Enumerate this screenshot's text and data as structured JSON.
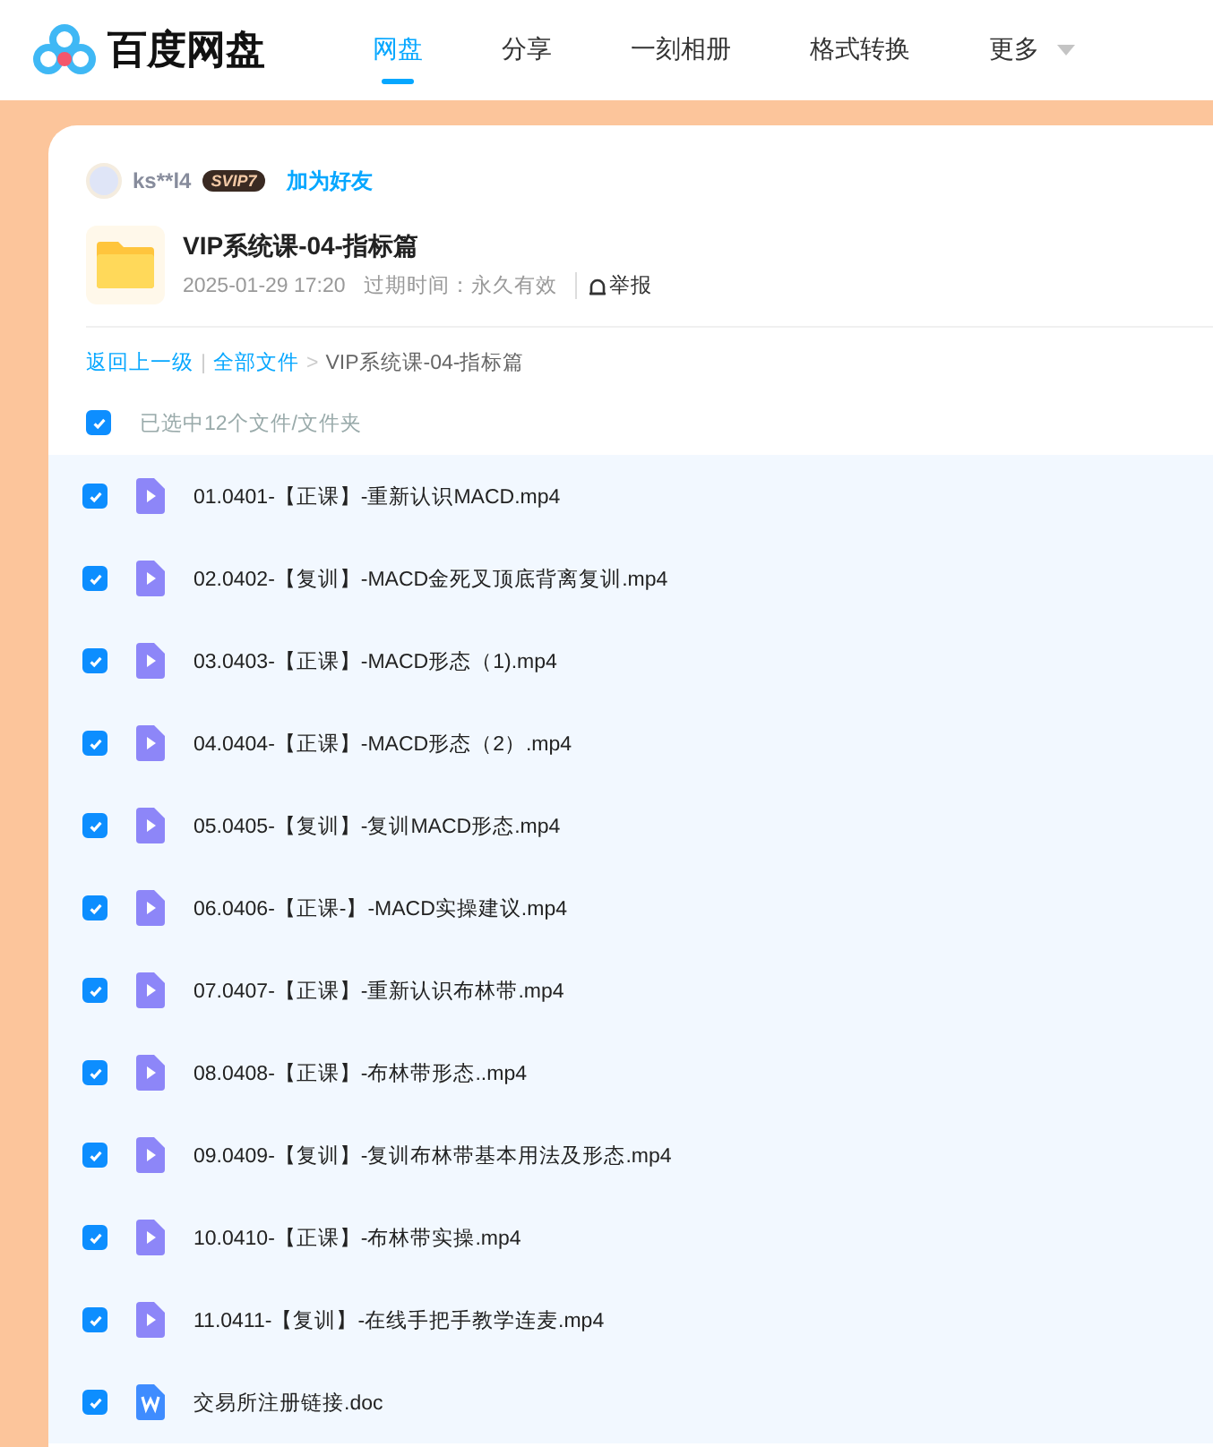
{
  "header": {
    "logo_text": "百度网盘",
    "tabs": [
      {
        "label": "网盘",
        "selected": true
      },
      {
        "label": "分享",
        "selected": false
      },
      {
        "label": "一刻相册",
        "selected": false
      },
      {
        "label": "格式转换",
        "selected": false
      },
      {
        "label": "更多",
        "selected": false,
        "dropdown": true
      }
    ]
  },
  "sharer": {
    "name": "ks**l4",
    "badge": "SVIP7",
    "add_friend": "加为好友"
  },
  "folder": {
    "title": "VIP系统课-04-指标篇",
    "date": "2025-01-29 17:20",
    "expiry": "过期时间：永久有效",
    "report": "举报"
  },
  "breadcrumb": {
    "back": "返回上一级",
    "divider": "|",
    "all": "全部文件",
    "separator": ">",
    "current": "VIP系统课-04-指标篇"
  },
  "select_all": {
    "label": "已选中12个文件/文件夹",
    "checked": true
  },
  "files": [
    {
      "name": "01.0401-【正课】-重新认识MACD.mp4",
      "kind": "video",
      "checked": true
    },
    {
      "name": "02.0402-【复训】-MACD金死叉顶底背离复训.mp4",
      "kind": "video",
      "checked": true
    },
    {
      "name": "03.0403-【正课】-MACD形态（1).mp4",
      "kind": "video",
      "checked": true
    },
    {
      "name": "04.0404-【正课】-MACD形态（2）.mp4",
      "kind": "video",
      "checked": true
    },
    {
      "name": "05.0405-【复训】-复训MACD形态.mp4",
      "kind": "video",
      "checked": true
    },
    {
      "name": "06.0406-【正课-】-MACD实操建议.mp4",
      "kind": "video",
      "checked": true
    },
    {
      "name": "07.0407-【正课】-重新认识布林带.mp4",
      "kind": "video",
      "checked": true
    },
    {
      "name": "08.0408-【正课】-布林带形态..mp4",
      "kind": "video",
      "checked": true
    },
    {
      "name": "09.0409-【复训】-复训布林带基本用法及形态.mp4",
      "kind": "video",
      "checked": true
    },
    {
      "name": "10.0410-【正课】-布林带实操.mp4",
      "kind": "video",
      "checked": true
    },
    {
      "name": "11.0411-【复训】-在线手把手教学连麦.mp4",
      "kind": "video",
      "checked": true
    },
    {
      "name": "交易所注册链接.doc",
      "kind": "doc",
      "checked": true
    }
  ]
}
